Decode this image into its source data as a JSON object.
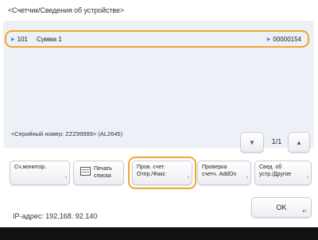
{
  "header": {
    "title": "<Счетчик/Сведения об устройстве>"
  },
  "list": {
    "rows": [
      {
        "id": "101",
        "name": "Сумма 1",
        "value": "00000154"
      }
    ]
  },
  "serial_text": "<Серийный номер: ZZZ99999> (AL2645)",
  "pager": {
    "indicator": "1/1"
  },
  "buttons": {
    "b1": {
      "line1": "Сч.монитор.",
      "line2": ""
    },
    "b2": {
      "line1": "Печать",
      "line2": "списка"
    },
    "b3": {
      "line1": "Пров. счет.",
      "line2": "Отпр./Факс"
    },
    "b4": {
      "line1": "Проверка",
      "line2": "счетч. AddOn"
    },
    "b5": {
      "line1": "Свед. об",
      "line2": "устр./Другое"
    }
  },
  "ip_text": "IP-адрес: 192.168. 92.140",
  "ok_label": "OK",
  "colors": {
    "highlight": "#f0a630",
    "panel": "#eef0f7",
    "marker": "#3a8bd6"
  }
}
